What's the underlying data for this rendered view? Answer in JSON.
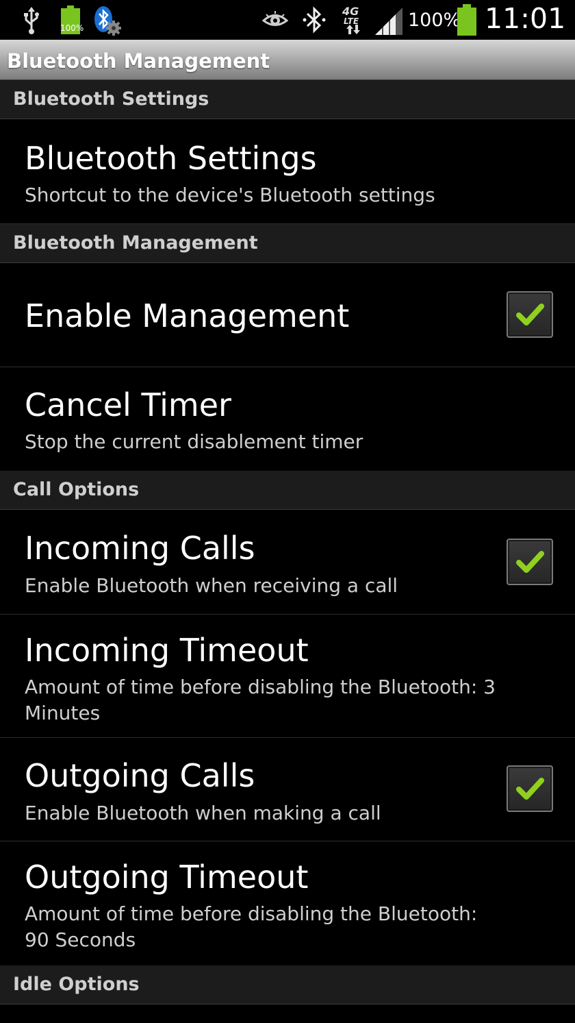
{
  "status_bar": {
    "icons": [
      "usb-icon",
      "battery-small-icon",
      "bluetooth-settings-icon",
      "eye-icon",
      "bluetooth-icon",
      "lte-4g-icon",
      "signal-icon",
      "battery-icon"
    ],
    "small_battery_label": "100%",
    "network_top": "4G",
    "network_bottom": "LTE",
    "battery_percent": "100%",
    "time": "11:01",
    "battery_color": "#7ac41f"
  },
  "app_bar": {
    "title": "Bluetooth Management"
  },
  "sections": [
    {
      "category": "Bluetooth Settings",
      "items": [
        {
          "title": "Bluetooth Settings",
          "summary": "Shortcut to the device's Bluetooth settings"
        }
      ]
    },
    {
      "category": "Bluetooth Management",
      "items": [
        {
          "title": "Enable Management",
          "checked": true
        },
        {
          "title": "Cancel Timer",
          "summary": "Stop the current disablement timer"
        }
      ]
    },
    {
      "category": "Call Options",
      "items": [
        {
          "title": "Incoming Calls",
          "summary": "Enable Bluetooth when receiving a call",
          "checked": true
        },
        {
          "title": "Incoming Timeout",
          "summary": "Amount of time before disabling the Bluetooth: 3 Minutes"
        },
        {
          "title": "Outgoing Calls",
          "summary": "Enable Bluetooth when making a call",
          "checked": true
        },
        {
          "title": "Outgoing Timeout",
          "summary": "Amount of time before disabling the Bluetooth: 90 Seconds"
        }
      ]
    },
    {
      "category": "Idle Options",
      "items": []
    }
  ],
  "colors": {
    "check_mark": "#8fd11e",
    "category_background": "#1c1c1c",
    "category_text": "#cfcfcf"
  }
}
